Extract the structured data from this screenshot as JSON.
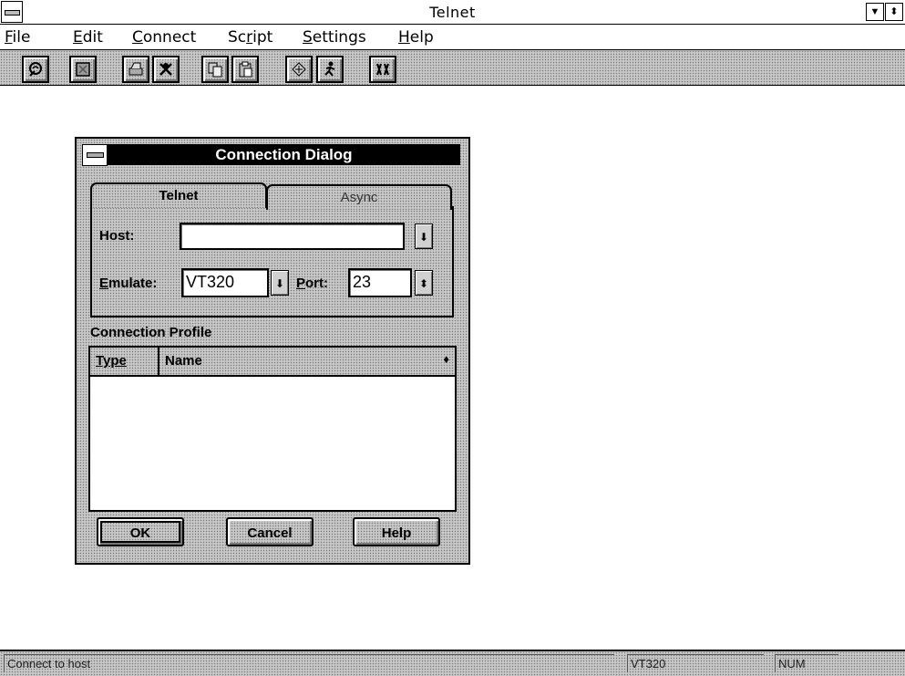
{
  "window": {
    "title": "Telnet"
  },
  "menu": {
    "items": [
      {
        "label_u": "F",
        "label_rest": "ile"
      },
      {
        "label_u": "E",
        "label_rest": "dit"
      },
      {
        "label_u": "C",
        "label_rest": "onnect"
      },
      {
        "label_pre": "Sc",
        "label_u": "r",
        "label_rest": "ipt"
      },
      {
        "label_u": "S",
        "label_rest": "ettings"
      },
      {
        "label_u": "H",
        "label_rest": "elp"
      }
    ]
  },
  "toolbar": {
    "icons": [
      "connect-icon",
      "disconnect-icon",
      "print-icon",
      "tools-icon",
      "copy-icon",
      "paste-icon",
      "network-icon",
      "run-script-icon",
      "scripts-icon"
    ]
  },
  "dialog": {
    "title": "Connection Dialog",
    "tabs": [
      "Telnet",
      "Async"
    ],
    "host_label": "Host:",
    "host_value": "",
    "emulate_label_u": "E",
    "emulate_label_rest": "mulate:",
    "emulate_value": "VT320",
    "port_label_u": "P",
    "port_label_rest": "ort:",
    "port_value": "23",
    "profile_title": "Connection Profile",
    "columns": [
      "Type",
      "Name"
    ],
    "rows": [],
    "buttons": {
      "ok": "OK",
      "cancel": "Cancel",
      "help": "Help"
    }
  },
  "status": {
    "message": "Connect to host",
    "emulation": "VT320",
    "num": "NUM"
  }
}
